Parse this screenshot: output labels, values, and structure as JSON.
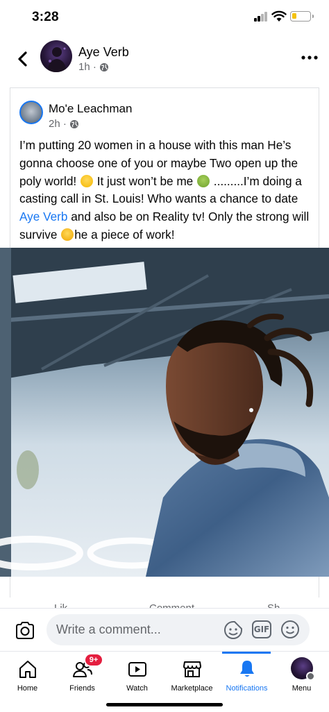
{
  "status_bar": {
    "time": "3:28"
  },
  "header": {
    "name": "Aye Verb",
    "time": "1h ·",
    "icons": {
      "back": "chevron-left-icon",
      "audience": "globe-icon",
      "more": "more-horizontal-icon"
    }
  },
  "shared_post": {
    "author": "Mo'e Leachman",
    "time": "2h ·",
    "text_1": "I’m putting 20 women in a house with this man He’s gonna choose one of you or maybe Two open up the poly world!",
    "text_2": " It just won’t be me ",
    "text_3": " .........I’m doing a casting call in St. Louis! Who wants a chance to date ",
    "mention": "Aye Verb",
    "text_4": " and also be on Reality tv! Only the strong will survive ",
    "text_5": "he a piece of work!",
    "emojis": [
      "grinning-face-emoji",
      "nauseated-face-emoji",
      "tired-face-emoji"
    ]
  },
  "actions_peek": {
    "like": "Lik",
    "comment": "Comment",
    "share": "Sh"
  },
  "comment_bar": {
    "placeholder": "Write a comment...",
    "gif_label": "GIF",
    "icons": [
      "camera-icon",
      "sticker-icon",
      "gif-icon",
      "emoji-icon"
    ]
  },
  "tab_bar": {
    "tabs": [
      {
        "label": "Home",
        "icon": "home-icon"
      },
      {
        "label": "Friends",
        "icon": "friends-icon",
        "badge": "9+"
      },
      {
        "label": "Watch",
        "icon": "watch-icon"
      },
      {
        "label": "Marketplace",
        "icon": "marketplace-icon"
      },
      {
        "label": "Notifications",
        "icon": "bell-icon",
        "active": true
      },
      {
        "label": "Menu",
        "icon": "profile-avatar"
      }
    ]
  },
  "colors": {
    "accent": "#1877f2",
    "badge": "#e41e3f",
    "secondary_text": "#65676b",
    "input_bg": "#f0f2f5"
  }
}
